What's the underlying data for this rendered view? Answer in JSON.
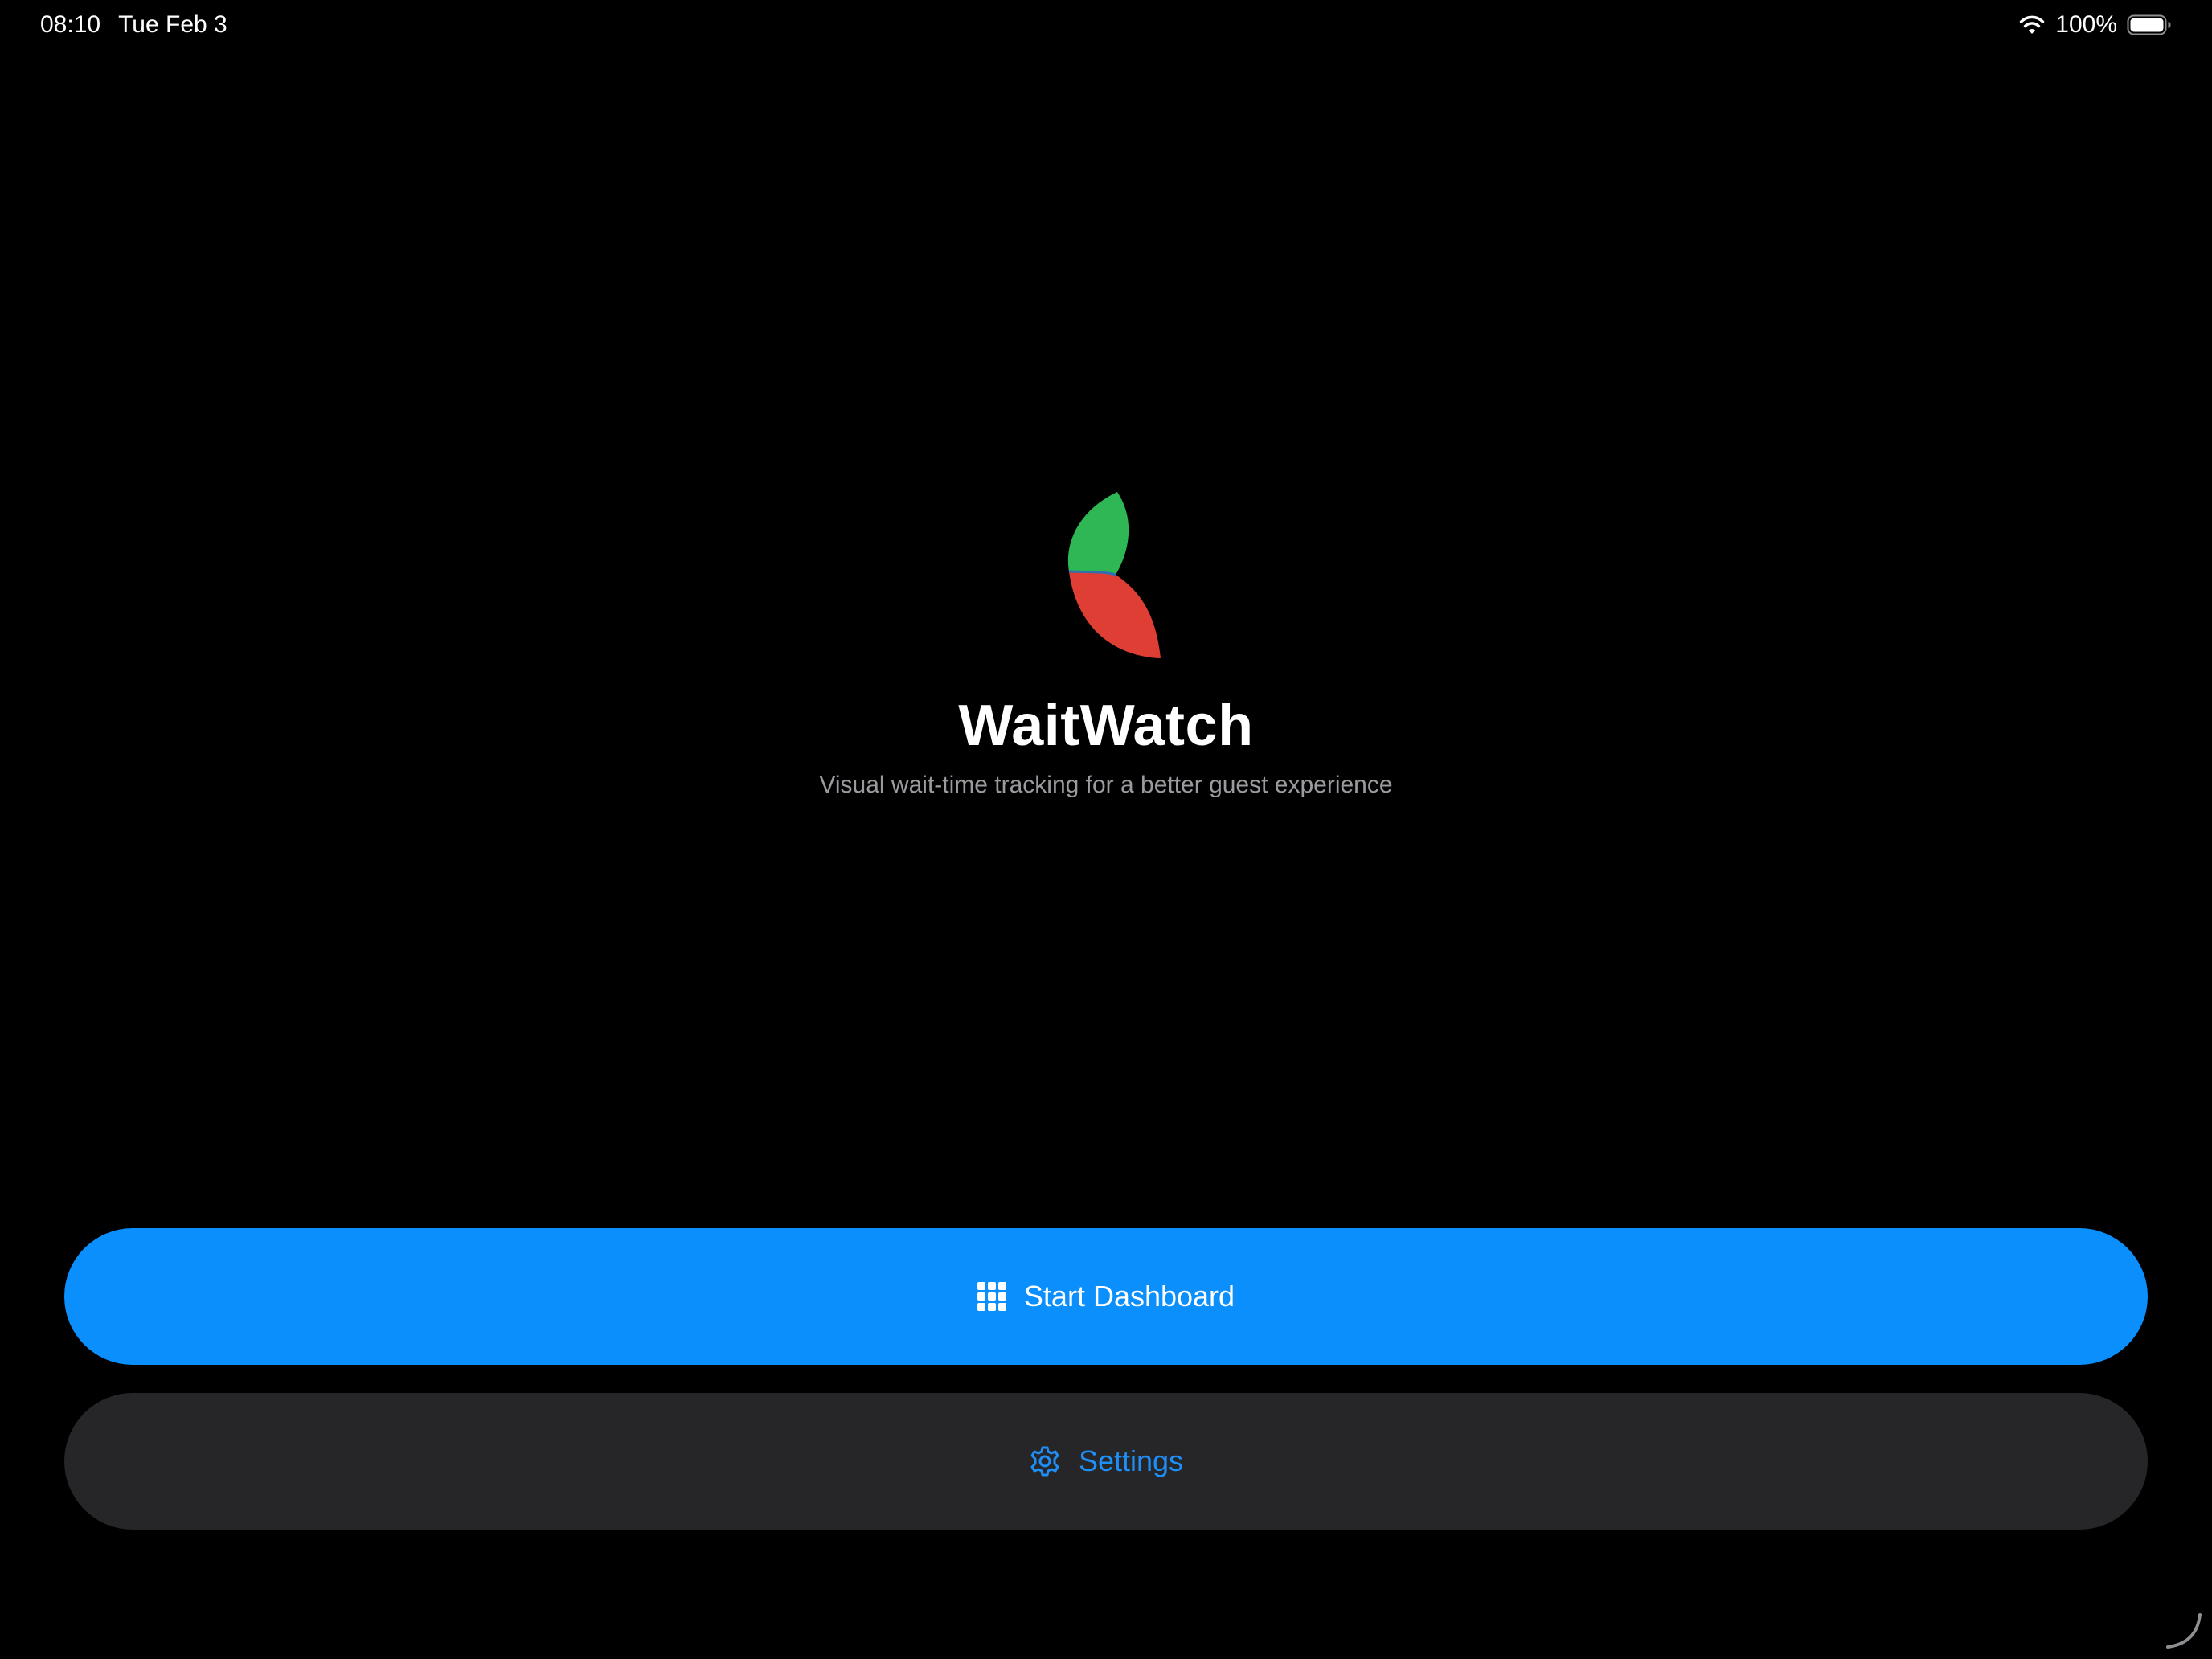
{
  "status_bar": {
    "time": "08:10",
    "date": "Tue Feb 3",
    "battery_percent": "100%"
  },
  "app": {
    "title": "WaitWatch",
    "subtitle": "Visual wait-time tracking for a better guest experience"
  },
  "buttons": {
    "start_dashboard": "Start Dashboard",
    "settings": "Settings"
  },
  "icons": {
    "logo": "waitwatch-logo-icon",
    "start": "grid-icon",
    "settings": "gear-icon"
  },
  "colors": {
    "background": "#000000",
    "primary": "#0a8ffd",
    "secondary_button": "#262629",
    "settings_text": "#1f8ff8",
    "logo_green": "#30b755",
    "logo_red": "#de3e33",
    "subtitle": "#9a9a9f"
  }
}
